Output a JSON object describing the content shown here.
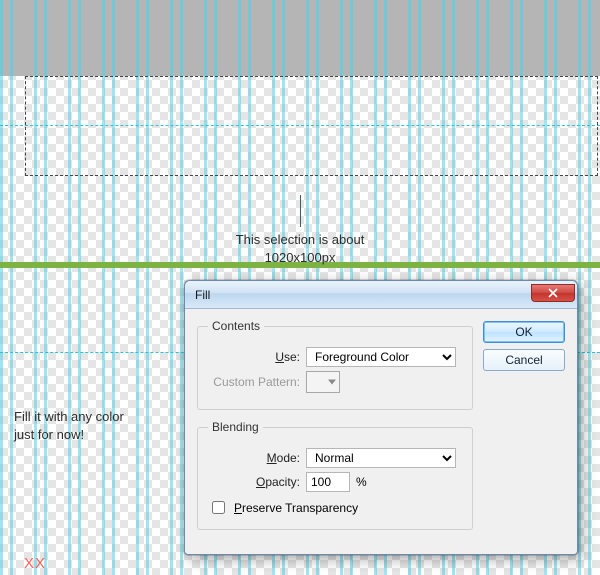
{
  "annotations": {
    "selection_text_l1": "This selection is about",
    "selection_text_l2": "1020x100px",
    "fill_hint_l1": "Fill it with any color",
    "fill_hint_l2": "just for now!",
    "watermark": "XX"
  },
  "dialog": {
    "title": "Fill",
    "contents": {
      "legend": "Contents",
      "use_label": "Use:",
      "use_value": "Foreground Color",
      "custom_pattern_label": "Custom Pattern:"
    },
    "blending": {
      "legend": "Blending",
      "mode_label": "Mode:",
      "mode_value": "Normal",
      "opacity_label": "Opacity:",
      "opacity_value": "100",
      "opacity_unit": "%",
      "preserve_label": "Preserve Transparency",
      "preserve_checked": false
    },
    "buttons": {
      "ok": "OK",
      "cancel": "Cancel"
    }
  }
}
